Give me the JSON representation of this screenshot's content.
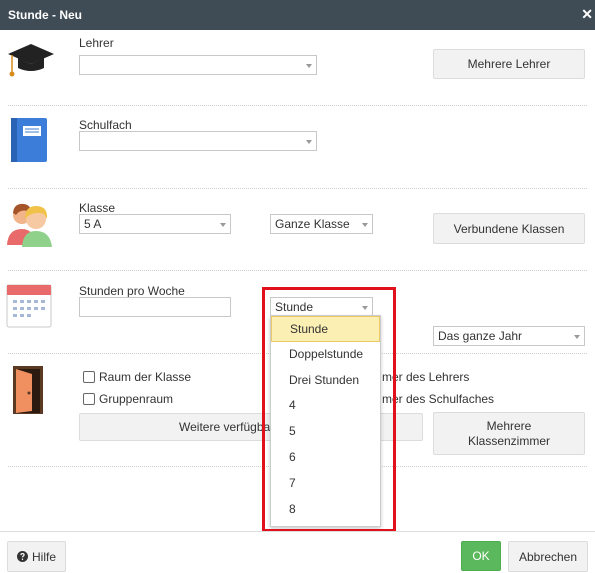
{
  "window": {
    "title": "Stunde - Neu",
    "close_glyph": "✕"
  },
  "lehrer": {
    "label": "Lehrer",
    "value": "",
    "button": "Mehrere Lehrer"
  },
  "schulfach": {
    "label": "Schulfach",
    "value": ""
  },
  "klasse": {
    "label": "Klasse",
    "value": "5 A",
    "scope_value": "Ganze Klasse",
    "button": "Verbundene Klassen"
  },
  "stunden": {
    "label": "Stunden pro Woche",
    "count_value": "",
    "type_value": "Stunde",
    "period_value": "Das ganze Jahr",
    "dropdown_options": [
      "Stunde",
      "Doppelstunde",
      "Drei Stunden",
      "4",
      "5",
      "6",
      "7",
      "8"
    ],
    "selected_option": "Stunde"
  },
  "raum": {
    "cb_raum_der_klasse": "Raum der Klasse",
    "cb_raum_des_lehrers_tail": "mer des Lehrers",
    "cb_gruppenraum": "Gruppenraum",
    "cb_raum_des_schulfaches_tail": "mer des Schulfaches",
    "weitere_button_visible": "Weitere verfügba",
    "mehrere_button_line1": "Mehrere",
    "mehrere_button_line2": "Klassenzimmer"
  },
  "footer": {
    "hilfe": "Hilfe",
    "ok": "OK",
    "abbrechen": "Abbrechen"
  },
  "colors": {
    "titlebar": "#3f4b55",
    "ok_green": "#5cb85c",
    "highlight_red": "#e0101c",
    "selected_option_bg": "#fcefb4"
  },
  "icons": {
    "lehrer": "graduation-cap-icon",
    "schulfach": "book-icon",
    "klasse": "students-icon",
    "stunden": "calendar-icon",
    "raum": "door-icon",
    "hilfe": "question-circle-icon"
  }
}
